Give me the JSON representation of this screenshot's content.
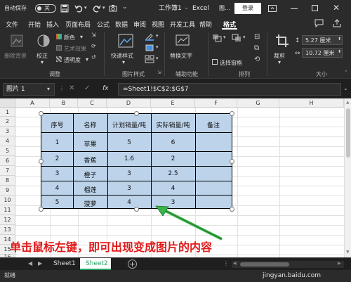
{
  "titlebar": {
    "autosave_label": "自动保存",
    "autosave_state": "关",
    "file_title": "工作簿1",
    "separator": "-",
    "app_name": "Excel",
    "context_tab": "图...",
    "login_label": "登录"
  },
  "menu": {
    "items": [
      "文件",
      "开始",
      "插入",
      "页面布局",
      "公式",
      "数据",
      "审阅",
      "视图",
      "开发工具",
      "帮助",
      "格式"
    ],
    "active": "格式"
  },
  "ribbon": {
    "remove_bg": "删除背景",
    "correct": "校正",
    "color": "颜色",
    "artistic": "艺术效果",
    "transparency": "透明度",
    "adjust_group": "调整",
    "quick_styles": "快速样式",
    "picture_styles_group": "图片样式",
    "alt_text": "替换文字",
    "accessibility_group": "辅助功能",
    "selection_pane": "选择窗格",
    "arrange_group": "排列",
    "crop": "裁剪",
    "height_value": "5.27 厘米",
    "width_value": "10.72 厘米",
    "size_group": "大小"
  },
  "formula_bar": {
    "name_box": "图片 1",
    "fx": "fx",
    "formula": "=Sheet1!$C$2:$G$7"
  },
  "grid": {
    "columns": [
      "A",
      "B",
      "C",
      "D",
      "E",
      "F",
      "G",
      "H"
    ],
    "rows": [
      "1",
      "2",
      "3",
      "4",
      "5",
      "6",
      "7",
      "8",
      "9",
      "10",
      "11",
      "12",
      "13",
      "14",
      "15",
      "16"
    ]
  },
  "table": {
    "headers": [
      "序号",
      "名称",
      "计划销量/吨",
      "实际销量/吨",
      "备注"
    ],
    "rows": [
      [
        "1",
        "苹果",
        "5",
        "6",
        ""
      ],
      [
        "2",
        "香蕉",
        "1.6",
        "2",
        ""
      ],
      [
        "3",
        "橙子",
        "3",
        "2.5",
        ""
      ],
      [
        "4",
        "榴莲",
        "3",
        "4",
        ""
      ],
      [
        "5",
        "菠萝",
        "4",
        "3",
        ""
      ]
    ]
  },
  "annotation": "单击鼠标左键，即可出现变成图片的内容",
  "sheet_tabs": {
    "tabs": [
      "Sheet1",
      "Sheet2"
    ],
    "active": "Sheet2",
    "add": "+"
  },
  "status": {
    "ready": "就绪",
    "watermark": "jingyan.baidu.com"
  },
  "colors": {
    "table_fill": "#bcd3ea",
    "annotation": "#e21a1a",
    "arrow": "#3bb54a",
    "active_tab": "#21a366"
  }
}
